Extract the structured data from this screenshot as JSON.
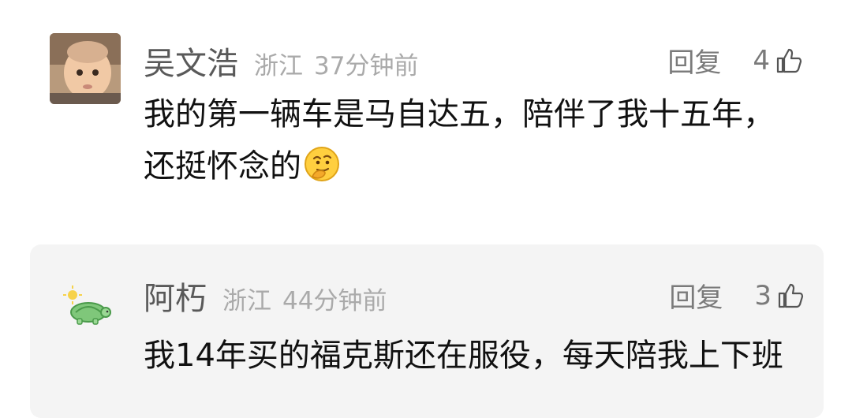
{
  "comments": [
    {
      "username": "吴文浩",
      "location": "浙江",
      "time": "37分钟前",
      "reply_label": "回复",
      "likes": "4",
      "text": "我的第一辆车是马自达五，陪伴了我十五年，还挺怀念的",
      "emoji": "thinking-face-emoji"
    },
    {
      "username": "阿朽",
      "location": "浙江",
      "time": "44分钟前",
      "reply_label": "回复",
      "likes": "3",
      "text": "我14年买的福克斯还在服役，每天陪我上下班"
    }
  ],
  "colors": {
    "username": "#595959",
    "meta": "#aaaaaa",
    "content": "#111111",
    "reply_bg": "#f4f4f4"
  },
  "icons": [
    "thumbs-up-icon",
    "avatar-child-photo",
    "avatar-turtle-cartoon"
  ]
}
